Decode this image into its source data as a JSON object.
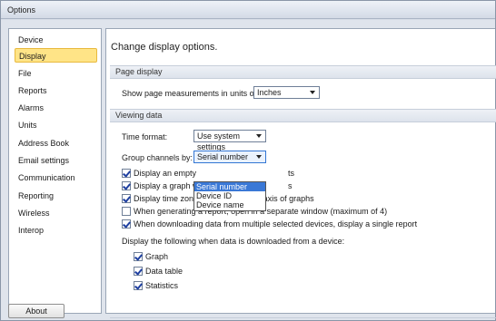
{
  "window": {
    "title": "Options"
  },
  "sidebar": {
    "items": [
      "Device",
      "Display",
      "File",
      "Reports",
      "Alarms",
      "Units",
      "Address Book",
      "Email settings",
      "Communication",
      "Reporting",
      "Wireless",
      "Interop"
    ],
    "selected": "Display"
  },
  "footer": {
    "about_label": "About"
  },
  "main": {
    "title": "Change display options.",
    "page_display": {
      "header": "Page display",
      "units_label": "Show page measurements in units of:",
      "units_value": "Inches"
    },
    "viewing_data": {
      "header": "Viewing data",
      "time_format_label": "Time format:",
      "time_format_value": "Use system settings",
      "group_label": "Group channels by:",
      "group_value": "Serial number",
      "group_options": [
        "Serial number",
        "Device ID",
        "Device name"
      ],
      "checkboxes": [
        {
          "label": "Display an empty",
          "suffix": "ts",
          "checked": true
        },
        {
          "label": "Display a graph w",
          "suffix": "s",
          "checked": true
        },
        {
          "label": "Display time zone on the horizontal axis of graphs",
          "checked": true
        },
        {
          "label": "When generating a report, open in a separate window (maximum of 4)",
          "checked": false
        },
        {
          "label": "When downloading data from multiple selected devices, display a single report",
          "checked": true
        }
      ],
      "download_label": "Display the following when data is downloaded from a device:",
      "download_options": [
        {
          "label": "Graph",
          "checked": true
        },
        {
          "label": "Data table",
          "checked": true
        },
        {
          "label": "Statistics",
          "checked": true
        }
      ]
    }
  }
}
